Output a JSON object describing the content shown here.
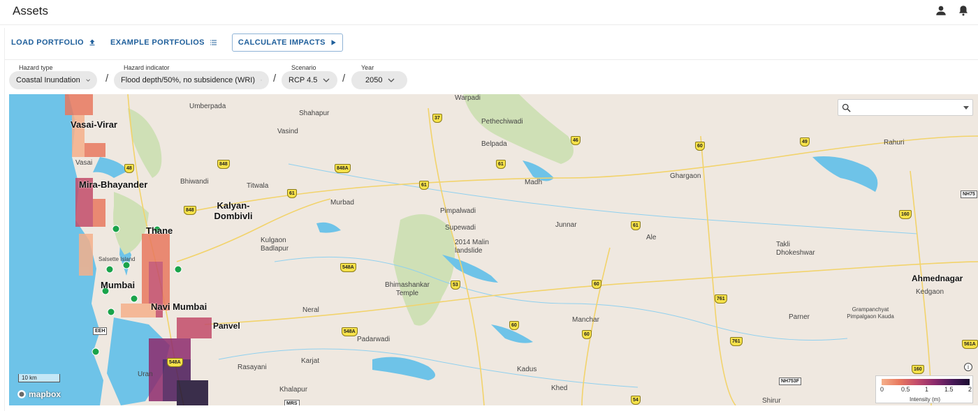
{
  "header": {
    "title": "Assets",
    "icons": [
      "user-icon",
      "bell-icon"
    ]
  },
  "toolbar": {
    "load_portfolio": "LOAD PORTFOLIO",
    "example_portfolios": "EXAMPLE PORTFOLIOS",
    "calculate_impacts": "CALCULATE IMPACTS"
  },
  "selectors": {
    "hazard_type": {
      "label": "Hazard type",
      "value": "Coastal Inundation"
    },
    "hazard_indicator": {
      "label": "Hazard indicator",
      "value": "Flood depth/50%, no subsidence (WRI)"
    },
    "scenario": {
      "label": "Scenario",
      "value": "RCP 4.5"
    },
    "year": {
      "label": "Year",
      "value": "2050"
    },
    "separator": "/"
  },
  "map": {
    "search_placeholder": "",
    "scale_label": "10 km",
    "attribution": "mapbox",
    "info": "i",
    "places": [
      "Warpadi",
      "Umberpada",
      "Shahapur",
      "Vasind",
      "Pethechiwadi",
      "Belpada",
      "Rahuri",
      "Vasai",
      "Bhiwandi",
      "Titwala",
      "Murbad",
      "Madh",
      "Ghargaon",
      "Pimpalwadi",
      "Supewadi",
      "Junnar",
      "Ale",
      "Kulgaon Badlapur",
      "2014 Malin landslide",
      "Takli Dhokeshwar",
      "Salsette Island",
      "Bhimashankar Temple",
      "Kedgaon",
      "Neral",
      "Manchar",
      "Grampanchyat Pimpalgaon Kauda",
      "Parner",
      "Padarwadi",
      "Karjat",
      "Rasayani",
      "Kadus",
      "Khed",
      "Khalapur",
      "Shirur",
      "Uran"
    ],
    "cities": [
      "Vasai-Virar",
      "Mira-Bhayander",
      "Thane",
      "Kalyan-Dombivli",
      "Mumbai",
      "Navi Mumbai",
      "Panvel",
      "Ahmednagar"
    ],
    "highway_shields": [
      "37",
      "61",
      "46",
      "48",
      "848",
      "848A",
      "60",
      "49",
      "848",
      "160",
      "61",
      "61",
      "61",
      "548A",
      "53",
      "60",
      "761",
      "548A",
      "60",
      "60",
      "761",
      "561A",
      "160",
      "548A",
      "54",
      "NH75",
      "NH753F",
      "EEH",
      "MRS"
    ],
    "legend": {
      "ticks": [
        "0",
        "0.5",
        "1",
        "1.5",
        "2"
      ],
      "title": "Intensity (m)",
      "colors": [
        "#f5b08b",
        "#e8795f",
        "#c34c6a",
        "#8e2b6d",
        "#4b1a5a",
        "#1b0e32"
      ]
    }
  },
  "colors": {
    "accent": "#1f5f9b",
    "asset_marker": "#1aa34a",
    "water": "#6ec3e8",
    "land": "#efe8e0"
  }
}
